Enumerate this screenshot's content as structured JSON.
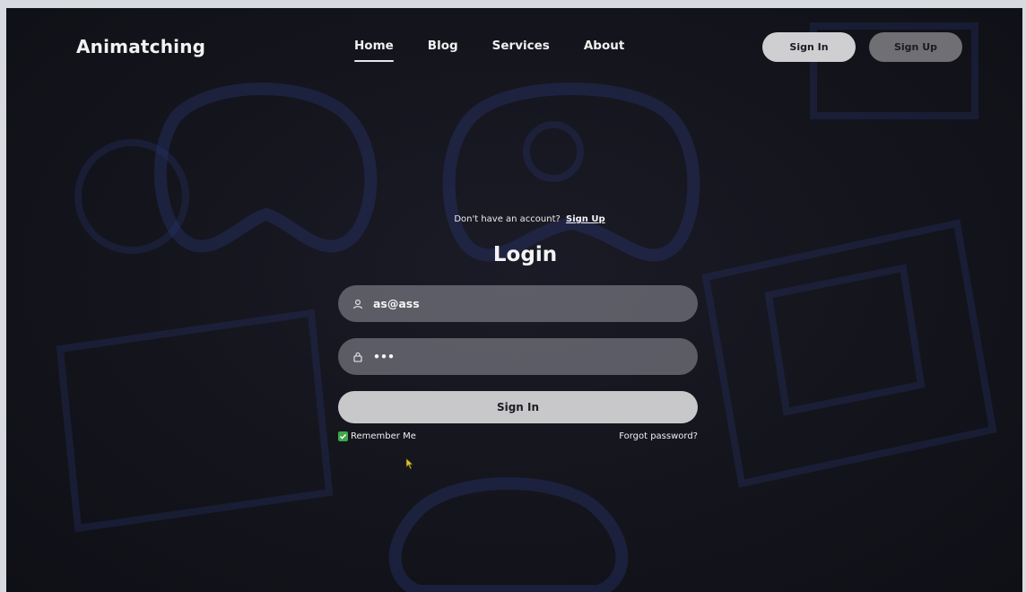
{
  "brand": {
    "name": "Animatching"
  },
  "nav": {
    "links": [
      {
        "label": "Home",
        "active": true
      },
      {
        "label": "Blog",
        "active": false
      },
      {
        "label": "Services",
        "active": false
      },
      {
        "label": "About",
        "active": false
      }
    ],
    "sign_in_label": "Sign In",
    "sign_up_label": "Sign Up"
  },
  "login": {
    "hint_text": "Don't have an account?",
    "hint_link": "Sign Up",
    "title": "Login",
    "username_value": "as@ass",
    "password_value": "•••",
    "submit_label": "Sign In",
    "remember_label": "Remember Me",
    "remember_checked": true,
    "forgot_label": "Forgot password?"
  },
  "icons": {
    "username": "user-icon",
    "password": "lock-icon",
    "checkbox": "checkmark-icon"
  },
  "colors": {
    "background": "#14141c",
    "accent_green": "#3fa84a",
    "button_light": "#c8c8cb",
    "button_dark": "#6f6f74"
  }
}
